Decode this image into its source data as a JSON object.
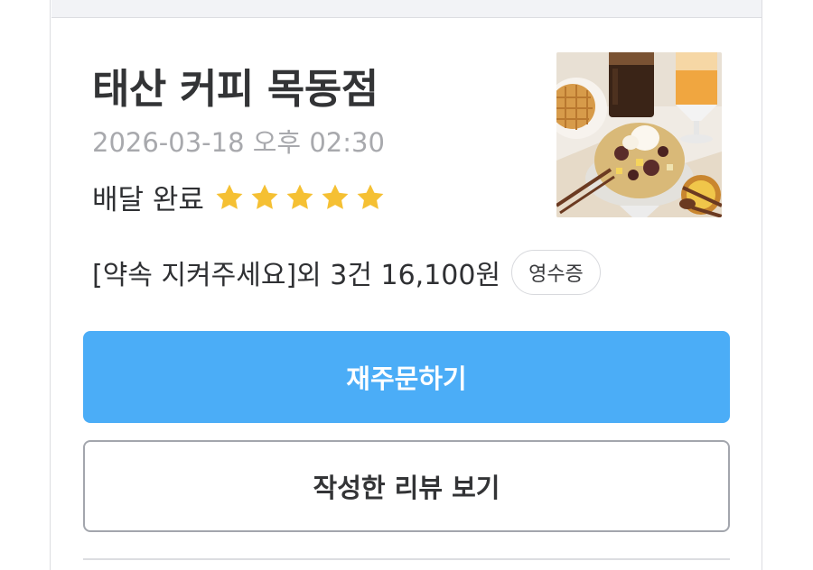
{
  "order": {
    "store_name": "태산 커피 목동점",
    "date": "2026-03-18 오후 02:30",
    "status": "배달 완료",
    "rating": 5,
    "summary": "[약속 지켜주세요]외 3건 16,100원",
    "receipt_label": "영수증"
  },
  "actions": {
    "reorder_label": "재주문하기",
    "review_label": "작성한 리뷰 보기"
  },
  "colors": {
    "primary": "#4badf7",
    "star": "#f5c033",
    "muted_text": "#a8a9ad",
    "text": "#333436",
    "border": "#dcdde1"
  },
  "thumbnail": {
    "icon": "store-food-photo"
  }
}
